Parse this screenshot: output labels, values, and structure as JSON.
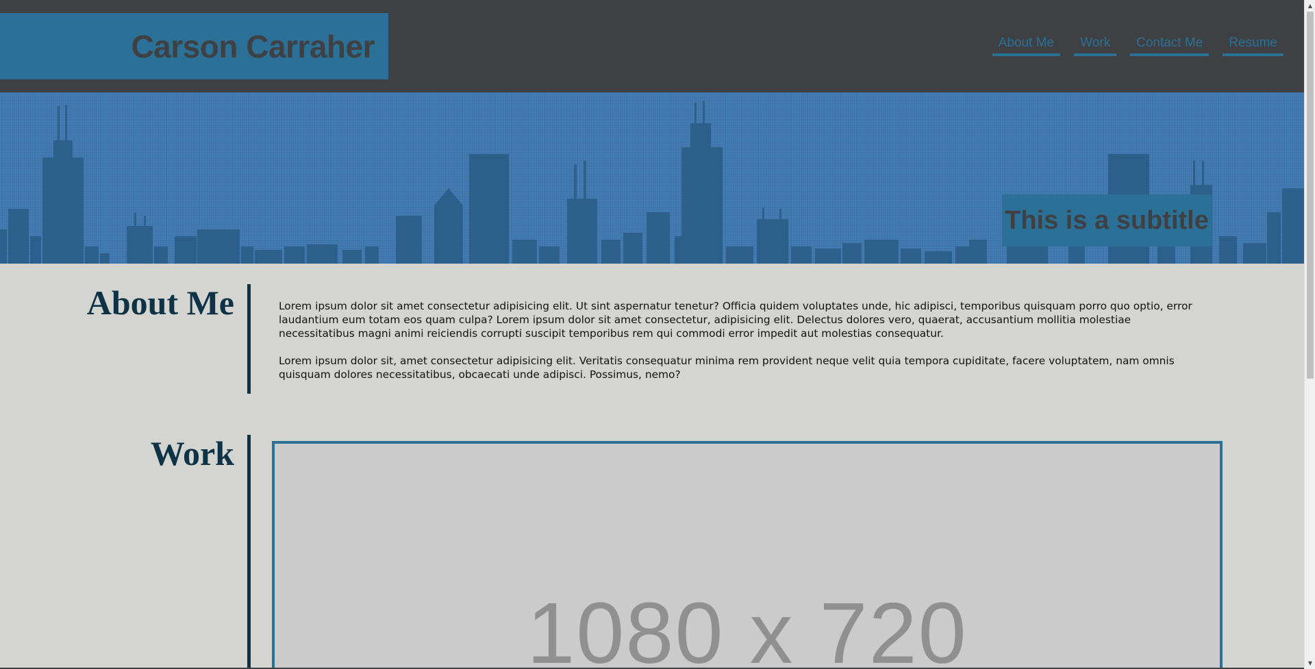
{
  "header": {
    "title": "Carson Carraher",
    "nav": [
      {
        "label": "About Me"
      },
      {
        "label": "Work"
      },
      {
        "label": "Contact Me"
      },
      {
        "label": "Resume"
      }
    ]
  },
  "hero": {
    "subtitle": "This is a subtitle"
  },
  "about": {
    "heading": "About Me",
    "paragraphs": [
      "Lorem ipsum dolor sit amet consectetur adipisicing elit. Ut sint aspernatur tenetur? Officia quidem voluptates unde, hic adipisci, temporibus quisquam porro quo optio, error laudantium eum totam eos quam culpa? Lorem ipsum dolor sit amet consectetur, adipisicing elit. Delectus dolores vero, quaerat, accusantium mollitia molestiae necessitatibus magni animi reiciendis corrupti suscipit temporibus rem qui commodi error impedit aut molestias consequatur.",
      "Lorem ipsum dolor sit, amet consectetur adipisicing elit. Veritatis consequatur minima rem provident neque velit quia tempora cupiditate, facere voluptatem, nam omnis quisquam dolores necessitatibus, obcaecati unde adipisci. Possimus, nemo?"
    ]
  },
  "work": {
    "heading": "Work",
    "placeholder": "1080 x 720"
  },
  "colors": {
    "header_bg": "#3f4043",
    "accent": "#2b7096",
    "hero_bg": "#3e77ae",
    "page_bg": "#d4d5d0",
    "heading": "#0e3347"
  },
  "icons": {
    "scroll_up": "scroll-up-arrow-icon",
    "scroll_down": "scroll-down-arrow-icon"
  }
}
